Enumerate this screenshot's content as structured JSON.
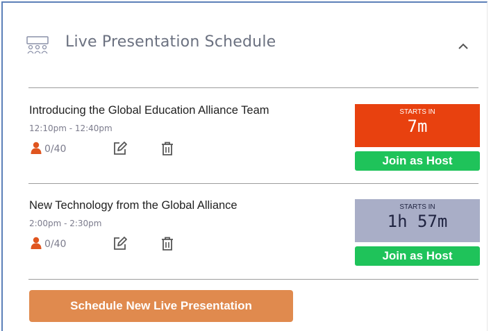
{
  "header": {
    "title": "Live Presentation Schedule",
    "icon": "people-group-icon",
    "collapse_icon": "chevron-up-icon"
  },
  "sessions": [
    {
      "name": "Introducing the Global Education Alliance Team",
      "time": "12:10pm - 12:40pm",
      "attendees": "0/40",
      "starts_label": "STARTS IN",
      "starts_value": "7m",
      "starts_bg": "#e8410f",
      "starts_fg": "#ffffff",
      "join_label": "Join as Host"
    },
    {
      "name": "New Technology from the Global Alliance",
      "time": "2:00pm - 2:30pm",
      "attendees": "0/40",
      "starts_label": "STARTS IN",
      "starts_value": "1h 57m",
      "starts_bg": "#a9aec7",
      "starts_fg": "#1f2340",
      "join_label": "Join as Host"
    }
  ],
  "footer": {
    "schedule_label": "Schedule New Live Presentation"
  },
  "colors": {
    "accent_orange": "#e08a4e",
    "join_green": "#1fc35a",
    "person_icon": "#e0551f"
  }
}
